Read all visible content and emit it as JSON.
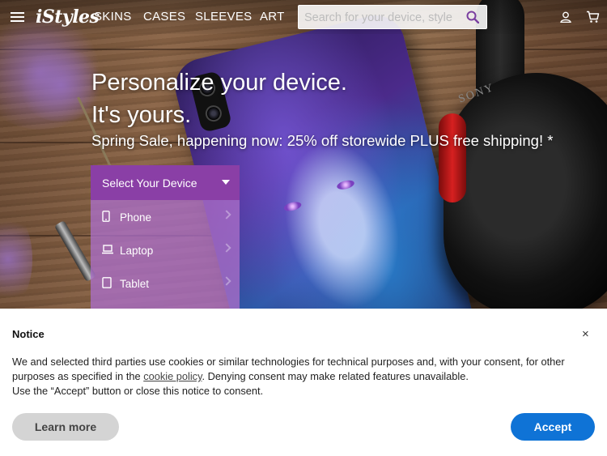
{
  "nav": {
    "logo": "iStyles",
    "links": [
      "SKINS",
      "CASES",
      "SLEEVES",
      "ART"
    ],
    "search_placeholder": "Search for your device, style"
  },
  "hero": {
    "title_line1": "Personalize your device.",
    "title_line2": "It's yours.",
    "subtitle": "Spring Sale, happening now: 25% off storewide PLUS free shipping! *"
  },
  "selector": {
    "heading": "Select Your Device",
    "items": [
      {
        "label": "Phone",
        "icon": "phone-icon"
      },
      {
        "label": "Laptop",
        "icon": "laptop-icon"
      },
      {
        "label": "Tablet",
        "icon": "tablet-icon"
      }
    ]
  },
  "notice": {
    "title": "Notice",
    "close": "×",
    "body_before_link": "We and selected third parties use cookies or similar technologies for technical purposes and, with your consent, for other purposes as specified in the ",
    "link_text": "cookie policy",
    "body_after_link": ". Denying consent may make related features unavailable.",
    "body_line2": "Use the “Accept” button or close this notice to consent.",
    "learn_more": "Learn more",
    "accept": "Accept"
  },
  "colors": {
    "selector_head": "#8a3fa6",
    "accept_button": "#0f73d6",
    "learn_button": "#d4d4d4"
  }
}
